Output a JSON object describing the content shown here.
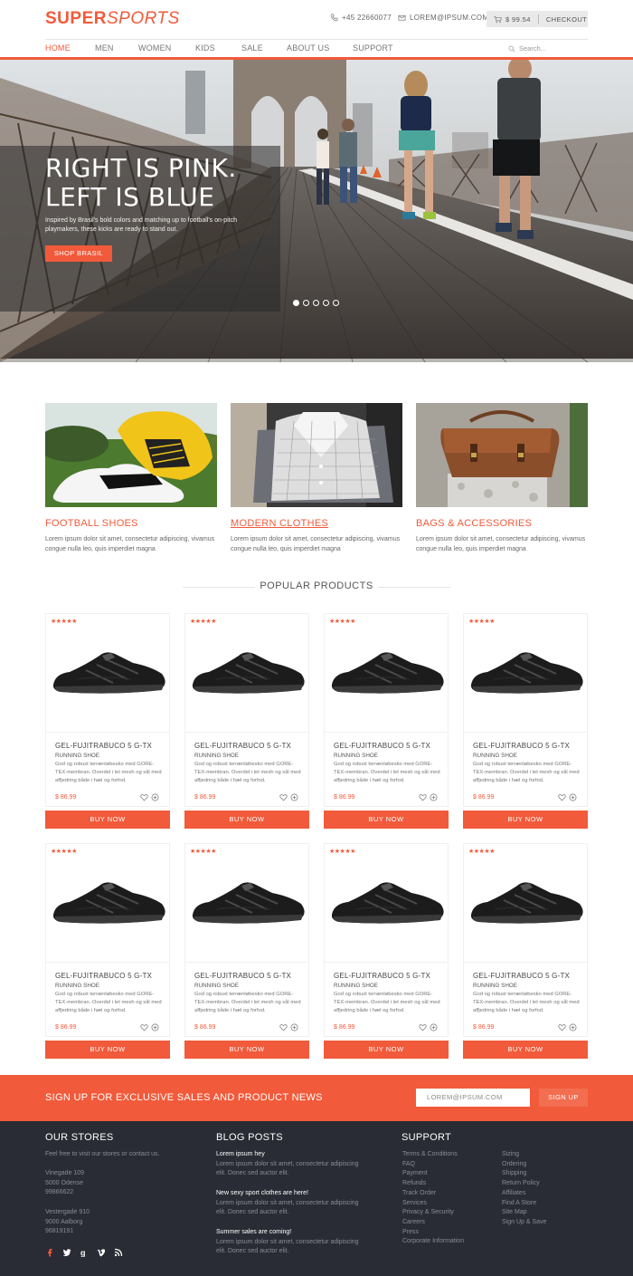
{
  "header": {
    "logo_bold": "SUPER",
    "logo_italic": "SPORTS",
    "phone": "+45 22660077",
    "email": "LOREM@IPSUM.COM",
    "cart_amount": "$ 99.54",
    "checkout_label": "CHECKOUT"
  },
  "nav": {
    "items": [
      "HOME",
      "MEN",
      "WOMEN",
      "KIDS",
      "SALE",
      "ABOUT US",
      "SUPPORT"
    ],
    "search_placeholder": "Search..."
  },
  "hero": {
    "title_line1": "RIGHT IS PINK.",
    "title_line2": "LEFT IS BLUE",
    "subtitle": "Inspired by Brasil's bold colors and matching up to football's on-pitch playmakers, these kicks are ready to stand out.",
    "button": "SHOP BRASIL"
  },
  "categories": [
    {
      "title": "FOOTBALL SHOES",
      "text": "Lorem ipsum dolor sit amet, consectetur adipiscing, vivamus congue nulla leo, quis imperdiet magna"
    },
    {
      "title": "MODERN CLOTHES",
      "text": "Lorem ipsum dolor sit amet, consectetur adipiscing, vivamus congue nulla leo, quis imperdiet magna"
    },
    {
      "title": "BAGS & ACCESSORIES",
      "text": "Lorem ipsum dolor sit amet, consectetur adipiscing, vivamus congue nulla leo, quis imperdiet magna"
    }
  ],
  "popular": {
    "heading": "POPULAR PRODUCTS",
    "products": [
      {
        "name": "GEL-FUJITRABUCO 5 G-TX",
        "type": "RUNNING SHOE",
        "desc": "God og robust terrænløbesko med GORE-TEX-membran. Overdel i let mesh og sål med affjedring både i hæl og forfod.",
        "price": "$ 86.99",
        "buy": "BUY NOW",
        "stars": "★★★★★"
      },
      {
        "name": "GEL-FUJITRABUCO 5 G-TX",
        "type": "RUNNING SHOE",
        "desc": "God og robust terrænløbesko med GORE-TEX-membran. Overdel i let mesh og sål med affjedring både i hæl og forfod.",
        "price": "$ 86.99",
        "buy": "BUY NOW",
        "stars": "★★★★★"
      },
      {
        "name": "GEL-FUJITRABUCO 5 G-TX",
        "type": "RUNNING SHOE",
        "desc": "God og robust terrænløbesko med GORE-TEX-membran. Overdel i let mesh og sål med affjedring både i hæl og forfod.",
        "price": "$ 86.99",
        "buy": "BUY NOW",
        "stars": "★★★★★"
      },
      {
        "name": "GEL-FUJITRABUCO 5 G-TX",
        "type": "RUNNING SHOE",
        "desc": "God og robust terrænløbesko med GORE-TEX-membran. Overdel i let mesh og sål med affjedring både i hæl og forfod.",
        "price": "$ 86.99",
        "buy": "BUY NOW",
        "stars": "★★★★★"
      },
      {
        "name": "GEL-FUJITRABUCO 5 G-TX",
        "type": "RUNNING SHOE",
        "desc": "God og robust terrænløbesko med GORE-TEX-membran. Overdel i let mesh og sål med affjedring både i hæl og forfod.",
        "price": "$ 86.99",
        "buy": "BUY NOW",
        "stars": "★★★★★"
      },
      {
        "name": "GEL-FUJITRABUCO 5 G-TX",
        "type": "RUNNING SHOE",
        "desc": "God og robust terrænløbesko med GORE-TEX-membran. Overdel i let mesh og sål med affjedring både i hæl og forfod.",
        "price": "$ 86.99",
        "buy": "BUY NOW",
        "stars": "★★★★★"
      },
      {
        "name": "GEL-FUJITRABUCO 5 G-TX",
        "type": "RUNNING SHOE",
        "desc": "God og robust terrænløbesko med GORE-TEX-membran. Overdel i let mesh og sål med affjedring både i hæl og forfod.",
        "price": "$ 86.99",
        "buy": "BUY NOW",
        "stars": "★★★★★"
      },
      {
        "name": "GEL-FUJITRABUCO 5 G-TX",
        "type": "RUNNING SHOE",
        "desc": "God og robust terrænløbesko med GORE-TEX-membran. Overdel i let mesh og sål med affjedring både i hæl og forfod.",
        "price": "$ 86.99",
        "buy": "BUY NOW",
        "stars": "★★★★★"
      }
    ]
  },
  "signup": {
    "text": "SIGN UP FOR EXCLUSIVE SALES AND PRODUCT NEWS",
    "placeholder": "LOREM@IPSUM.COM",
    "button": "SIGN UP"
  },
  "footer": {
    "stores_heading": "OUR STORES",
    "stores_intro": "Feel free to visit our stores or contact us.",
    "store1": [
      "Vinegade 109",
      "5000 Odense",
      "99866622"
    ],
    "store2": [
      "Vestergade 910",
      "9000 Aalborg",
      "96819191"
    ],
    "blog_heading": "BLOG POSTS",
    "posts": [
      {
        "title": "Lorem ipsum hey",
        "text": "Lorem ipsum dolor sit amet, consectetur adipiscing elit. Donec sed auctor elit."
      },
      {
        "title": "New sexy sport clothes are here!",
        "text": "Lorem ipsum dolor sit amet, consectetur adipiscing elit. Donec sed auctor elit."
      },
      {
        "title": "Summer sales are coming!",
        "text": "Lorem ipsum dolor sit amet, consectetur adipiscing elit. Donec sed auctor elit."
      }
    ],
    "support_heading": "SUPPORT",
    "support_col1": [
      "Terms & Conditions",
      "FAQ",
      "Payment",
      "Refunds",
      "Track Order",
      "Services",
      "Privacy & Security",
      "Careers",
      "Press",
      "Corporate Information"
    ],
    "support_col2": [
      "Sizing",
      "Ordering",
      "Shipping",
      "Return Policy",
      "Affiliates",
      "Find A Store",
      "Site Map",
      "Sign Up & Save"
    ]
  },
  "colors": {
    "accent": "#f15a3a",
    "footer_bg": "#2a2c35"
  }
}
